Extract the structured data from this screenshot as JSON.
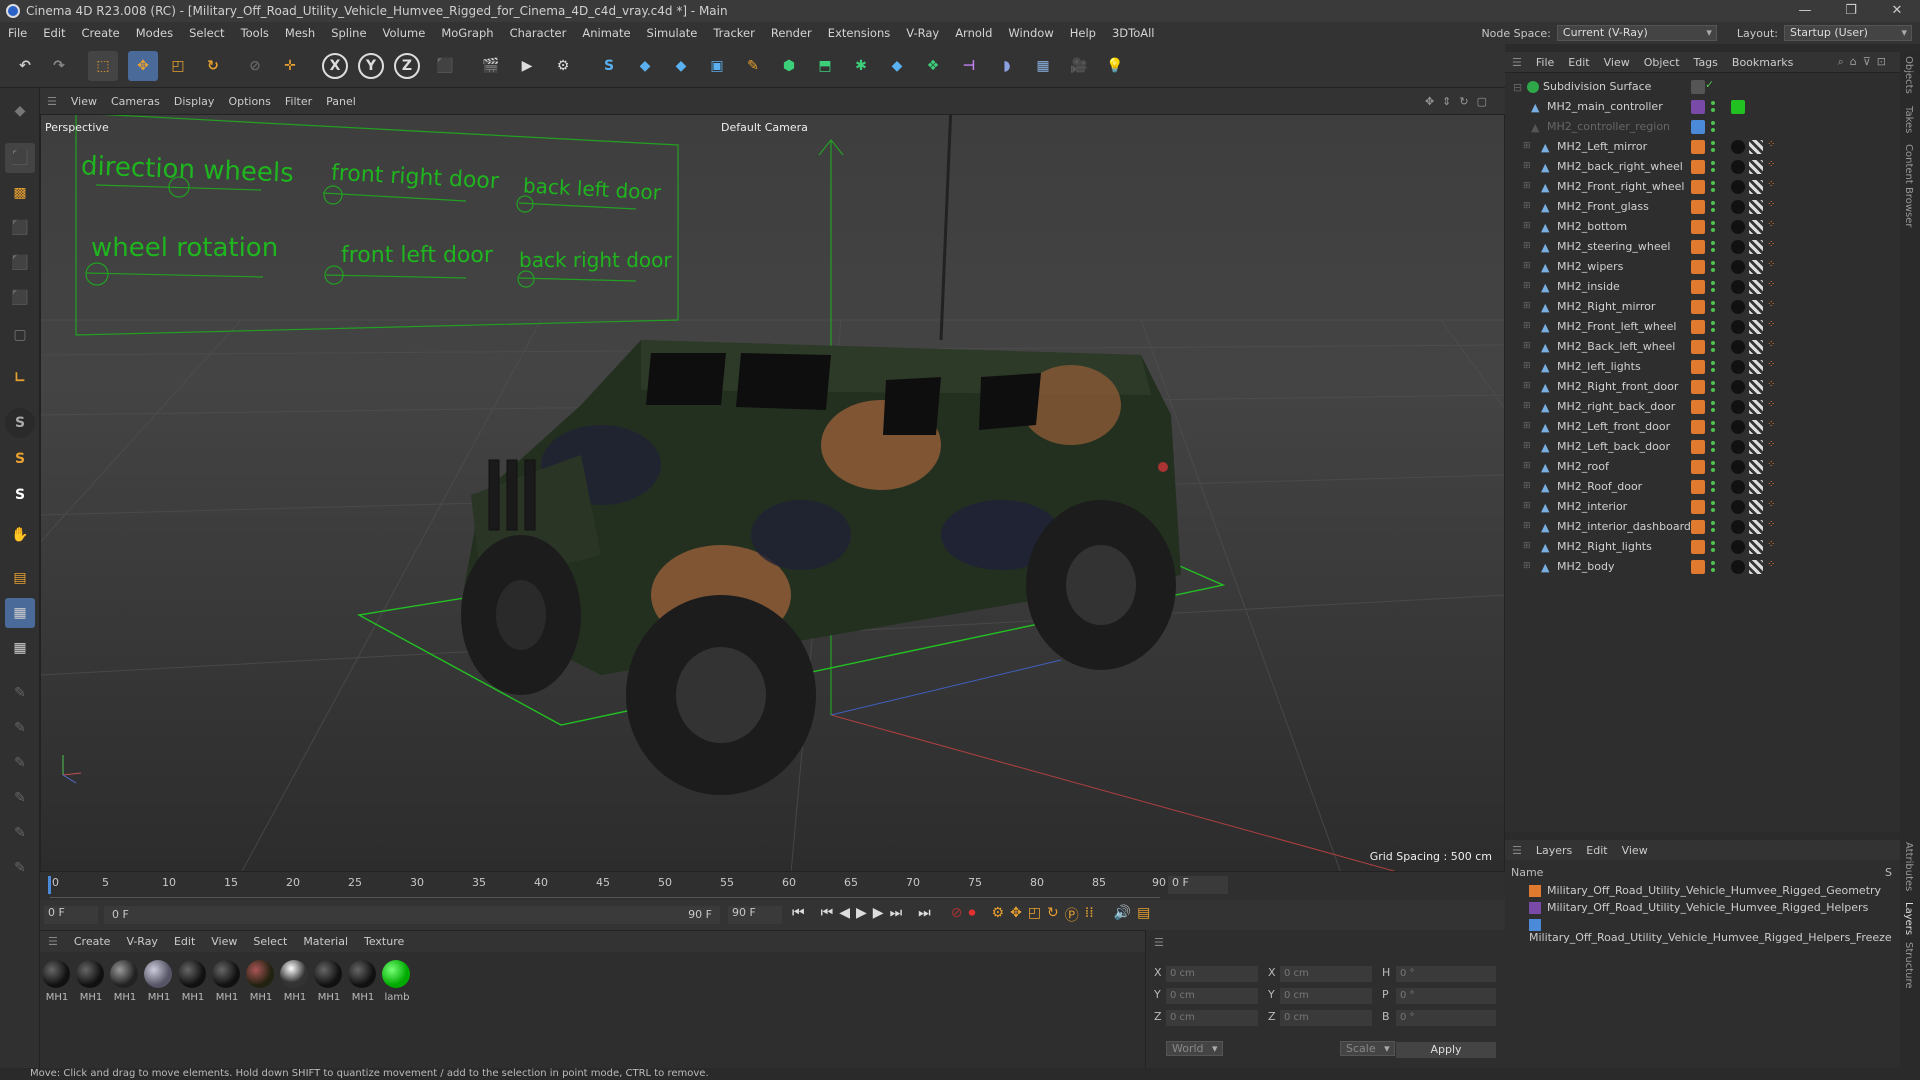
{
  "window": {
    "title": "Cinema 4D R23.008 (RC) - [Military_Off_Road_Utility_Vehicle_Humvee_Rigged_for_Cinema_4D_c4d_vray.c4d *] - Main"
  },
  "menu": {
    "items": [
      "File",
      "Edit",
      "Create",
      "Modes",
      "Select",
      "Tools",
      "Mesh",
      "Spline",
      "Volume",
      "MoGraph",
      "Character",
      "Animate",
      "Simulate",
      "Tracker",
      "Render",
      "Extensions",
      "V-Ray",
      "Arnold",
      "Window",
      "Help",
      "3DToAll"
    ],
    "node_space_label": "Node Space:",
    "node_space_value": "Current (V-Ray)",
    "layout_label": "Layout:",
    "layout_value": "Startup (User)"
  },
  "viewport": {
    "menu": [
      "View",
      "Cameras",
      "Display",
      "Options",
      "Filter",
      "Panel"
    ],
    "view_name": "Perspective",
    "camera": "Default Camera",
    "grid_spacing": "Grid Spacing : 500 cm",
    "controls": {
      "direction_wheels": "direction wheels",
      "front_right_door": "front right door",
      "back_left_door": "back left door",
      "wheel_rotation": "wheel rotation",
      "front_left_door": "front left door",
      "back_right_door": "back right door"
    }
  },
  "timeline": {
    "ticks": [
      "0",
      "5",
      "10",
      "15",
      "20",
      "25",
      "30",
      "35",
      "40",
      "45",
      "50",
      "55",
      "60",
      "65",
      "70",
      "75",
      "80",
      "85",
      "90"
    ],
    "current_frame_right": "0 F",
    "start_frame": "0 F",
    "range_start": "0 F",
    "range_end": "90 F",
    "end_frame": "90 F"
  },
  "materials": {
    "menu": [
      "Create",
      "V-Ray",
      "Edit",
      "View",
      "Select",
      "Material",
      "Texture"
    ],
    "items": [
      "MH1",
      "MH1",
      "MH1",
      "MH1",
      "MH1",
      "MH1",
      "MH1",
      "MH1",
      "MH1",
      "MH1",
      "lamb"
    ]
  },
  "coordinates": {
    "x_pos": "0 cm",
    "y_pos": "0 cm",
    "z_pos": "0 cm",
    "x_size": "0 cm",
    "y_size": "0 cm",
    "z_size": "0 cm",
    "h": "0 °",
    "p": "0 °",
    "b": "0 °",
    "mode1": "World",
    "mode2": "Scale",
    "apply": "Apply",
    "labels": {
      "x": "X",
      "y": "Y",
      "z": "Z",
      "h": "H",
      "p": "P",
      "b": "B"
    }
  },
  "objects": {
    "menu": [
      "File",
      "Edit",
      "View",
      "Object",
      "Tags",
      "Bookmarks"
    ],
    "root": "Subdivision Surface",
    "items": [
      {
        "name": "MH2_main_controller",
        "indent": 1
      },
      {
        "name": "MH2_controller_region",
        "indent": 1,
        "grey": true
      },
      {
        "name": "MH2_Left_mirror",
        "indent": 2
      },
      {
        "name": "MH2_back_right_wheel",
        "indent": 2
      },
      {
        "name": "MH2_Front_right_wheel",
        "indent": 2
      },
      {
        "name": "MH2_Front_glass",
        "indent": 2
      },
      {
        "name": "MH2_bottom",
        "indent": 2
      },
      {
        "name": "MH2_steering_wheel",
        "indent": 2
      },
      {
        "name": "MH2_wipers",
        "indent": 2
      },
      {
        "name": "MH2_inside",
        "indent": 2
      },
      {
        "name": "MH2_Right_mirror",
        "indent": 2
      },
      {
        "name": "MH2_Front_left_wheel",
        "indent": 2
      },
      {
        "name": "MH2_Back_left_wheel",
        "indent": 2
      },
      {
        "name": "MH2_left_lights",
        "indent": 2
      },
      {
        "name": "MH2_Right_front_door",
        "indent": 2
      },
      {
        "name": "MH2_right_back_door",
        "indent": 2
      },
      {
        "name": "MH2_Left_front_door",
        "indent": 2
      },
      {
        "name": "MH2_Left_back_door",
        "indent": 2
      },
      {
        "name": "MH2_roof",
        "indent": 2
      },
      {
        "name": "MH2_Roof_door",
        "indent": 2
      },
      {
        "name": "MH2_interior",
        "indent": 2
      },
      {
        "name": "MH2_interior_dashboard",
        "indent": 2
      },
      {
        "name": "MH2_Right_lights",
        "indent": 2
      },
      {
        "name": "MH2_body",
        "indent": 2
      }
    ]
  },
  "layers": {
    "menu": [
      "Layers",
      "Edit",
      "View"
    ],
    "name_header": "Name",
    "s_header": "S",
    "items": [
      {
        "name": "Military_Off_Road_Utility_Vehicle_Humvee_Rigged_Geometry",
        "color": "#e07a2e"
      },
      {
        "name": "Military_Off_Road_Utility_Vehicle_Humvee_Rigged_Helpers",
        "color": "#7a4aa8"
      },
      {
        "name": "Military_Off_Road_Utility_Vehicle_Humvee_Rigged_Helpers_Freeze",
        "color": "#4a8ad8"
      }
    ]
  },
  "side_tabs": [
    "Objects",
    "Takes",
    "Content Browser",
    "Attributes",
    "Layers",
    "Structure"
  ],
  "status": "Move: Click and drag to move elements. Hold down SHIFT to quantize movement / add to the selection in point mode, CTRL to remove.",
  "colors": {
    "accent_green": "#22c122",
    "orange": "#e07a2e"
  }
}
